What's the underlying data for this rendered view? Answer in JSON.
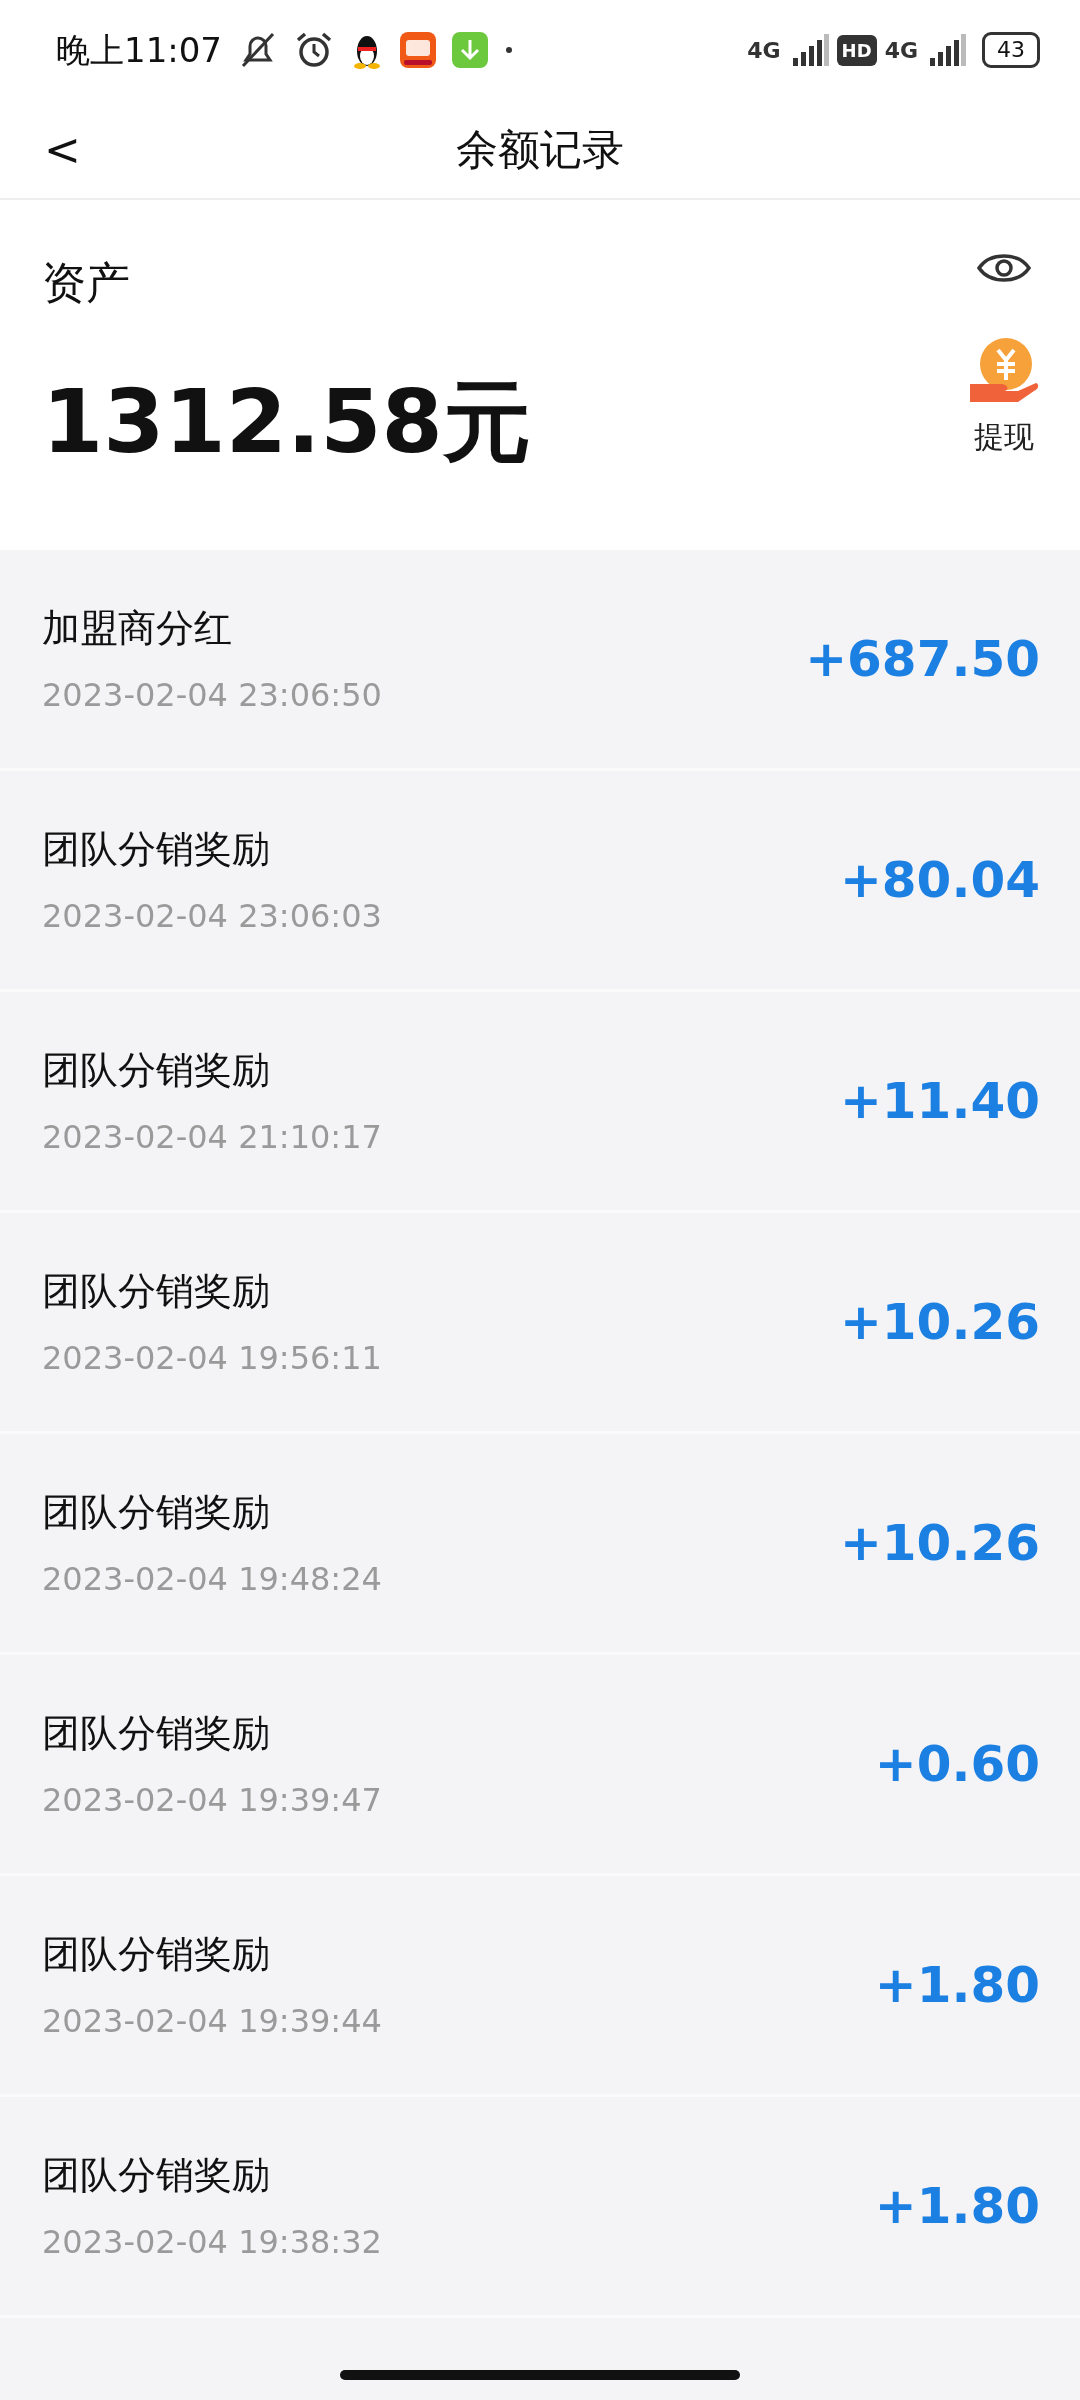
{
  "status_bar": {
    "time": "晚上11:07",
    "sim1": "4G",
    "hd": "HD",
    "sim2": "4G",
    "battery": "43"
  },
  "header": {
    "back": "<",
    "title": "余额记录"
  },
  "assets": {
    "label": "资产",
    "amount": "1312.58元",
    "withdraw": "提现"
  },
  "records": [
    {
      "title": "加盟商分红",
      "time": "2023-02-04 23:06:50",
      "amount": "+687.50"
    },
    {
      "title": "团队分销奖励",
      "time": "2023-02-04 23:06:03",
      "amount": "+80.04"
    },
    {
      "title": "团队分销奖励",
      "time": "2023-02-04 21:10:17",
      "amount": "+11.40"
    },
    {
      "title": "团队分销奖励",
      "time": "2023-02-04 19:56:11",
      "amount": "+10.26"
    },
    {
      "title": "团队分销奖励",
      "time": "2023-02-04 19:48:24",
      "amount": "+10.26"
    },
    {
      "title": "团队分销奖励",
      "time": "2023-02-04 19:39:47",
      "amount": "+0.60"
    },
    {
      "title": "团队分销奖励",
      "time": "2023-02-04 19:39:44",
      "amount": "+1.80"
    },
    {
      "title": "团队分销奖励",
      "time": "2023-02-04 19:38:32",
      "amount": "+1.80"
    }
  ]
}
